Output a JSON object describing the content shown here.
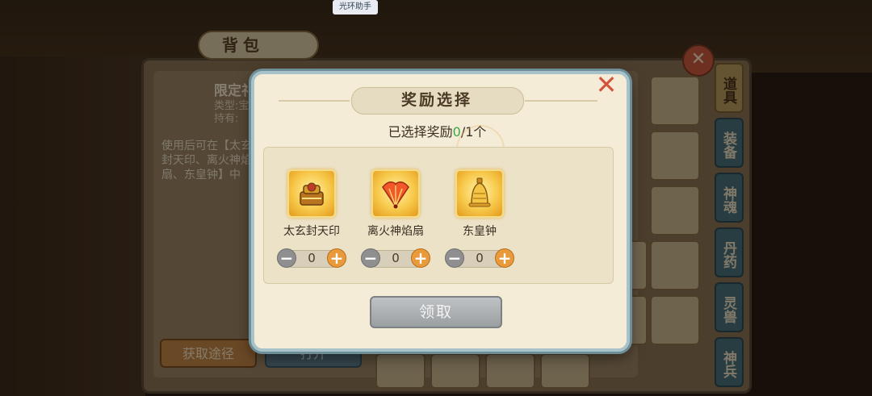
{
  "toast": {
    "label": "光环助手"
  },
  "background": {
    "bag_title": "背包",
    "item_name": "限定礼",
    "item_type": "类型:宝",
    "item_owned": "持有:",
    "item_desc": "使用后可在【太玄封天印、离火神焰扇、东皇钟】中",
    "get_button": "获取途径",
    "open_button": "打开",
    "side_tabs": [
      "道具",
      "装备",
      "神魂",
      "丹药",
      "灵兽",
      "神兵"
    ]
  },
  "modal": {
    "title": "奖励选择",
    "selected_prefix": "已选择奖励",
    "selected_count": "0",
    "selected_suffix": "/1个",
    "rewards": [
      {
        "name": "太玄封天印",
        "quantity": "0",
        "icon": "seal-icon"
      },
      {
        "name": "离火神焰扇",
        "quantity": "0",
        "icon": "flame-fan-icon"
      },
      {
        "name": "东皇钟",
        "quantity": "0",
        "icon": "bell-icon"
      }
    ],
    "claim_button": "领取"
  },
  "colors": {
    "accent_green": "#3aa84a",
    "close_red": "#d4533a",
    "plus_orange": "#e99a3a"
  }
}
